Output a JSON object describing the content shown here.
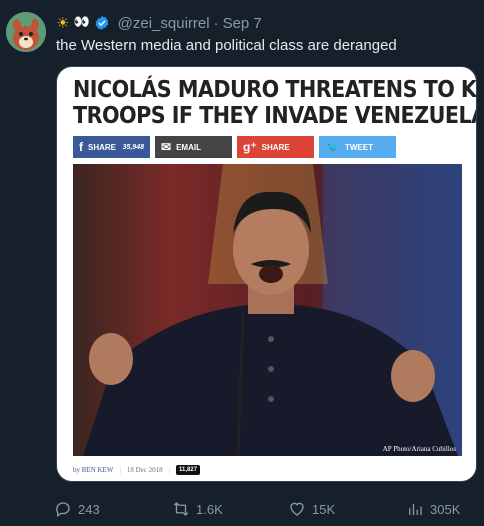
{
  "tweet": {
    "handle": "@zei_squirrel",
    "separator": "·",
    "date": "Sep 7",
    "name_emoji_sun": "☀",
    "name_emoji_eyes": "👀",
    "text": "the Western media and political class are deranged"
  },
  "article": {
    "headline_line1": "NICOLÁS MADURO THREATENS TO KILL U.S.",
    "headline_line2": "TROOPS IF THEY INVADE VENEZUELA",
    "share_buttons": {
      "facebook_label": "SHARE",
      "facebook_count": "35,948",
      "email_label": "EMAIL",
      "gplus_label": "SHARE",
      "twitter_label": "TWEET"
    },
    "photo_credit": "AP Photo/Ariana Cubillos",
    "byline_author": "by BEN KEW",
    "byline_date": "18 Dec 2018",
    "comment_count": "11,827"
  },
  "actions": {
    "replies": "243",
    "retweets": "1.6K",
    "likes": "15K",
    "views": "305K"
  },
  "colors": {
    "background": "#15202b",
    "secondary_text": "#8b98a5",
    "verified_blue": "#1d9bf0",
    "facebook": "#3b5998",
    "email": "#444444",
    "google_plus": "#db4437",
    "twitter": "#55acee"
  }
}
